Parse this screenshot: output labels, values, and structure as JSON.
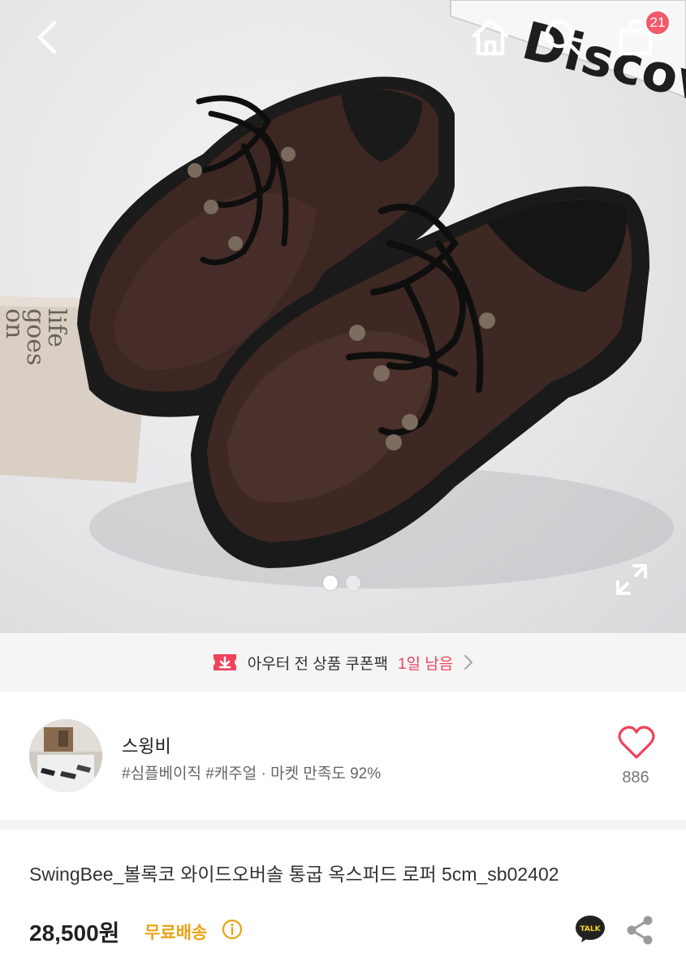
{
  "header": {
    "cart_count": "21",
    "back_icon": "chevron-left-icon",
    "home_icon": "home-icon",
    "search_icon": "search-icon",
    "cart_icon": "shopping-bag-icon"
  },
  "gallery": {
    "current_slide": 1,
    "total_slides": 2,
    "background_text_book": "life goes on",
    "background_text_box": "Discover",
    "expand_icon": "expand-icon"
  },
  "coupon": {
    "icon": "coupon-download-icon",
    "label": "아우터 전 상품 쿠폰팩",
    "remaining": "1일 남음",
    "accent": "#f0425c"
  },
  "seller": {
    "name": "스윙비",
    "tags": "#심플베이직 #캐주얼 · 마켓 만족도 92%",
    "likes": "886",
    "heart_color": "#f0425c"
  },
  "product": {
    "title": "SwingBee_볼록코 와이드오버솔 통굽 옥스퍼드 로퍼 5cm_sb02402",
    "price": "28,500원",
    "shipping": "무료배송",
    "shipping_color": "#e9a317",
    "talk_label": "TALK"
  }
}
